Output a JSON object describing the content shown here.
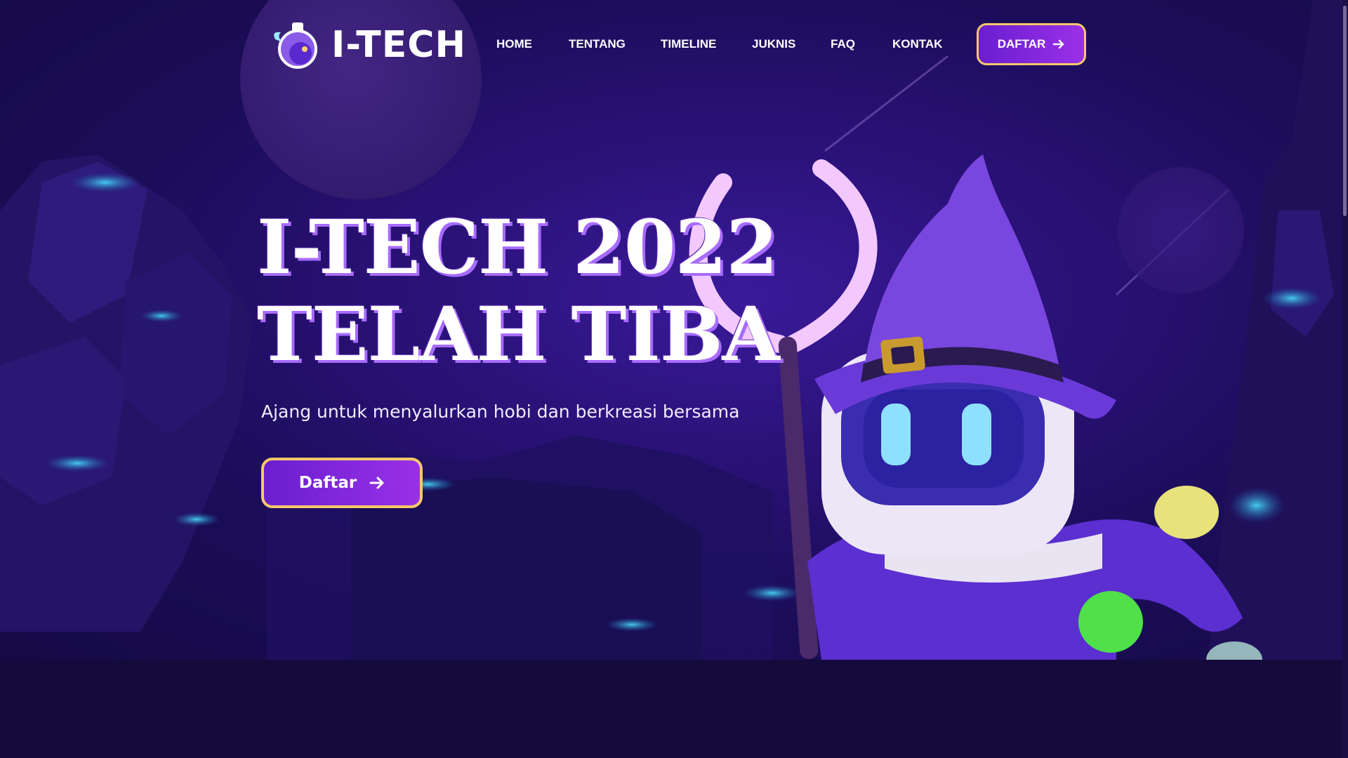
{
  "brand": {
    "name": "I-TECH",
    "icon": "potion-logo-icon"
  },
  "nav": {
    "items": [
      {
        "label": "HOME"
      },
      {
        "label": "TENTANG"
      },
      {
        "label": "TIMELINE"
      },
      {
        "label": "JUKNIS"
      },
      {
        "label": "FAQ"
      },
      {
        "label": "KONTAK"
      }
    ],
    "cta_label": "DAFTAR",
    "cta_icon": "arrow-right-icon"
  },
  "hero": {
    "title_line1": "I-TECH 2022",
    "title_line2": "TELAH TIBA",
    "subtitle": "Ajang untuk menyalurkan hobi dan berkreasi bersama",
    "cta_label": "Daftar",
    "cta_icon": "arrow-right-icon"
  },
  "colors": {
    "background": "#1c0d5a",
    "button_gradient_start": "#6a1ed0",
    "button_gradient_end": "#9a30e8",
    "button_border": "#f6c86a",
    "title_shadow": "#a76bff"
  }
}
